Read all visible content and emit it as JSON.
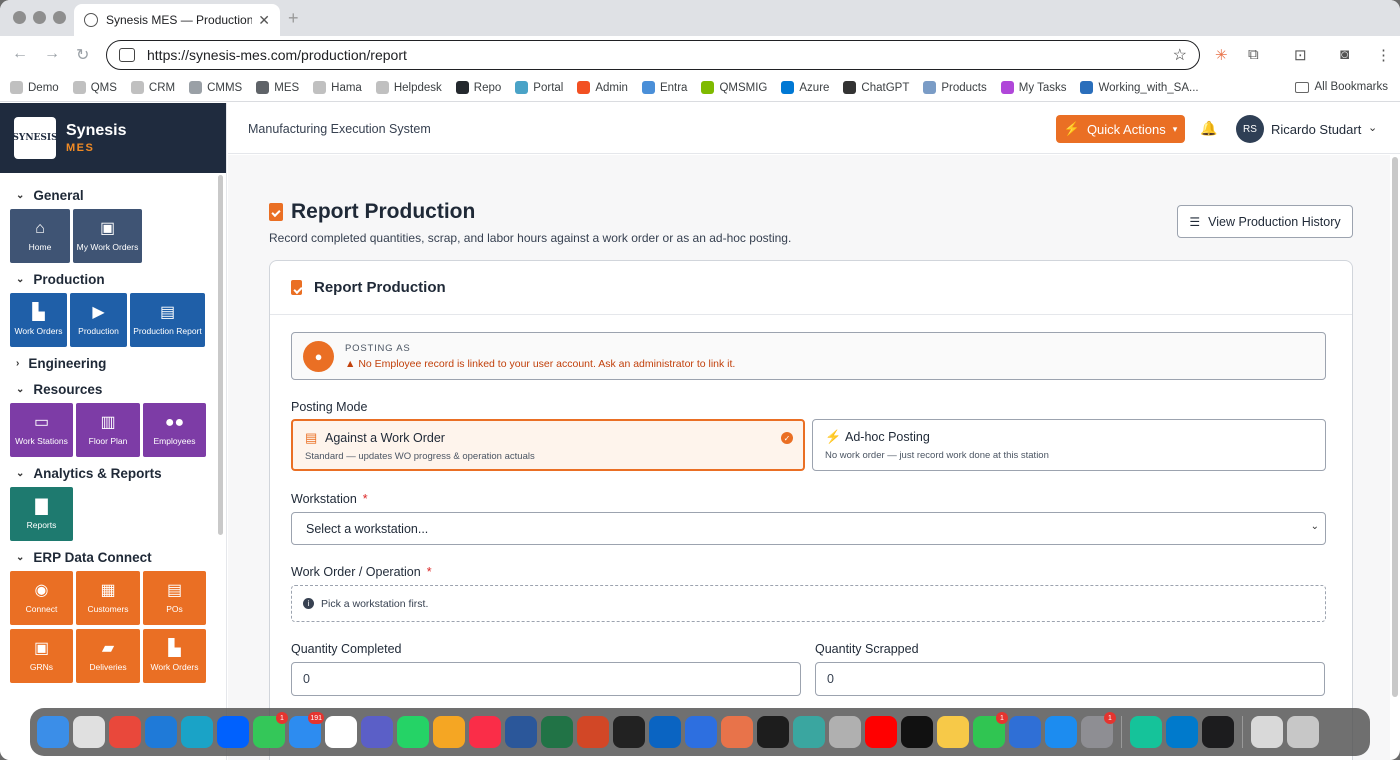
{
  "browser": {
    "tab_title": "Synesis MES — Production Tr",
    "url": "https://synesis-mes.com/production/report",
    "bookmarks": [
      {
        "label": "Demo",
        "color": "#c0c0c0"
      },
      {
        "label": "QMS",
        "color": "#c0c0c0"
      },
      {
        "label": "CRM",
        "color": "#c0c0c0"
      },
      {
        "label": "CMMS",
        "color": "#9aa0a6"
      },
      {
        "label": "MES",
        "color": "#5f6368"
      },
      {
        "label": "Hama",
        "color": "#c0c0c0"
      },
      {
        "label": "Helpdesk",
        "color": "#c0c0c0"
      },
      {
        "label": "Repo",
        "color": "#24292e"
      },
      {
        "label": "Portal",
        "color": "#4aa3c7"
      },
      {
        "label": "Admin",
        "color": "#f25022"
      },
      {
        "label": "Entra",
        "color": "#4a8fd8"
      },
      {
        "label": "QMSMIG",
        "color": "#7fba00"
      },
      {
        "label": "Azure",
        "color": "#0078d4"
      },
      {
        "label": "ChatGPT",
        "color": "#333333"
      },
      {
        "label": "Products",
        "color": "#7a9cc6"
      },
      {
        "label": "My Tasks",
        "color": "#b047d9"
      },
      {
        "label": "Working_with_SA...",
        "color": "#2a6ebb"
      }
    ],
    "all_bookmarks": "All Bookmarks"
  },
  "brand": {
    "logo_text": "SYNESIS",
    "name": "Synesis",
    "sub": "MES"
  },
  "sidebar": {
    "sections": [
      {
        "title": "General",
        "expanded": true,
        "tiles": [
          {
            "label": "Home",
            "icon": "home-icon",
            "glyph": "⌂",
            "color": "slate",
            "width": 60
          },
          {
            "label": "My Work Orders",
            "icon": "clipboard-icon",
            "glyph": "▣",
            "color": "slate",
            "width": 69
          }
        ]
      },
      {
        "title": "Production",
        "expanded": true,
        "tiles": [
          {
            "label": "Work Orders",
            "icon": "factory-icon",
            "glyph": "▙",
            "color": "blue",
            "width": 57
          },
          {
            "label": "Production",
            "icon": "play-icon",
            "glyph": "▶",
            "color": "blue",
            "width": 57
          },
          {
            "label": "Production Report",
            "icon": "document-icon",
            "glyph": "▤",
            "color": "blue",
            "width": 75
          }
        ]
      },
      {
        "title": "Engineering",
        "expanded": false,
        "tiles": []
      },
      {
        "title": "Resources",
        "expanded": true,
        "tiles": [
          {
            "label": "Work Stations",
            "icon": "monitor-icon",
            "glyph": "▭",
            "color": "purple",
            "width": 63
          },
          {
            "label": "Floor Plan",
            "icon": "map-icon",
            "glyph": "▥",
            "color": "purple",
            "width": 64
          },
          {
            "label": "Employees",
            "icon": "users-icon",
            "glyph": "●●",
            "color": "purple",
            "width": 63
          }
        ]
      },
      {
        "title": "Analytics & Reports",
        "expanded": true,
        "tiles": [
          {
            "label": "Reports",
            "icon": "bar-chart-icon",
            "glyph": "▇",
            "color": "teal",
            "width": 63
          }
        ]
      },
      {
        "title": "ERP Data Connect",
        "expanded": true,
        "tiles": [
          {
            "label": "Connect",
            "icon": "database-icon",
            "glyph": "◉",
            "color": "orange",
            "width": 63
          },
          {
            "label": "Customers",
            "icon": "building-icon",
            "glyph": "▦",
            "color": "orange",
            "width": 64
          },
          {
            "label": "POs",
            "icon": "document-icon",
            "glyph": "▤",
            "color": "orange",
            "width": 63
          }
        ]
      },
      {
        "title": "",
        "expanded": true,
        "tiles": [
          {
            "label": "GRNs",
            "icon": "box-icon",
            "glyph": "▣",
            "color": "orange",
            "width": 63
          },
          {
            "label": "Deliveries",
            "icon": "truck-icon",
            "glyph": "▰",
            "color": "orange",
            "width": 64
          },
          {
            "label": "Work Orders",
            "icon": "factory-icon",
            "glyph": "▙",
            "color": "orange",
            "width": 63
          }
        ]
      }
    ]
  },
  "topbar": {
    "title": "Manufacturing Execution System",
    "quick_actions": "Quick Actions",
    "avatar_initials": "RS",
    "username": "Ricardo Studart"
  },
  "page": {
    "title": "Report Production",
    "description": "Record completed quantities, scrap, and labor hours against a work order or as an ad-hoc posting.",
    "history_button": "View Production History"
  },
  "card": {
    "title": "Report Production",
    "posting_as_label": "POSTING AS",
    "posting_as_warning": "No Employee record is linked to your user account. Ask an administrator to link it.",
    "posting_mode_label": "Posting Mode",
    "modes": [
      {
        "title": "Against a Work Order",
        "desc": "Standard — updates WO progress & operation actuals",
        "selected": true
      },
      {
        "title": "Ad-hoc Posting",
        "desc": "No work order — just record work done at this station",
        "selected": false
      }
    ],
    "workstation_label": "Workstation",
    "workstation_placeholder": "Select a workstation...",
    "work_order_label": "Work Order / Operation",
    "work_order_hint": "Pick a workstation first.",
    "qty_completed_label": "Quantity Completed",
    "qty_completed_value": "0",
    "qty_scrapped_label": "Quantity Scrapped",
    "qty_scrapped_value": "0",
    "required_mark": "*"
  },
  "dock": [
    {
      "name": "finder",
      "color": "#3b8ee8"
    },
    {
      "name": "launchpad",
      "color": "#e0e0e0"
    },
    {
      "name": "chrome",
      "color": "#e9483b"
    },
    {
      "name": "windows-app",
      "color": "#1f7ad8"
    },
    {
      "name": "edge",
      "color": "#1aa3c7"
    },
    {
      "name": "dropbox",
      "color": "#0061fe"
    },
    {
      "name": "messages",
      "color": "#34c759",
      "badge": "1"
    },
    {
      "name": "mail",
      "color": "#2d8cf0",
      "badge": "191"
    },
    {
      "name": "calendar",
      "color": "#ffffff"
    },
    {
      "name": "teams",
      "color": "#5b5fc7"
    },
    {
      "name": "whatsapp",
      "color": "#25d366"
    },
    {
      "name": "photos",
      "color": "#f5a623"
    },
    {
      "name": "music",
      "color": "#fa2d48"
    },
    {
      "name": "word",
      "color": "#2b579a"
    },
    {
      "name": "excel",
      "color": "#217346"
    },
    {
      "name": "powerpoint",
      "color": "#d24726"
    },
    {
      "name": "terminal",
      "color": "#222222"
    },
    {
      "name": "outlook",
      "color": "#0a64c2"
    },
    {
      "name": "scripts",
      "color": "#2d6fe0"
    },
    {
      "name": "claude",
      "color": "#e8734a"
    },
    {
      "name": "activity-monitor",
      "color": "#1d1d1d"
    },
    {
      "name": "time-machine",
      "color": "#3aa6a0"
    },
    {
      "name": "contacts",
      "color": "#b0b0b0"
    },
    {
      "name": "youtube",
      "color": "#ff0000"
    },
    {
      "name": "apple-tv",
      "color": "#111111"
    },
    {
      "name": "preview",
      "color": "#f7c948"
    },
    {
      "name": "facetime",
      "color": "#30c552",
      "badge": "1"
    },
    {
      "name": "quicktime",
      "color": "#2f6fd6"
    },
    {
      "name": "app-store",
      "color": "#1c8cf0"
    },
    {
      "name": "system-settings",
      "color": "#8e8e93",
      "badge": "1"
    },
    {
      "name": "grammarly",
      "color": "#15c39a"
    },
    {
      "name": "vscode",
      "color": "#007acc"
    },
    {
      "name": "stocks",
      "color": "#1c1c1e"
    },
    {
      "name": "downloads",
      "color": "#d9d9d9"
    },
    {
      "name": "trash",
      "color": "#c7c7c7"
    }
  ]
}
